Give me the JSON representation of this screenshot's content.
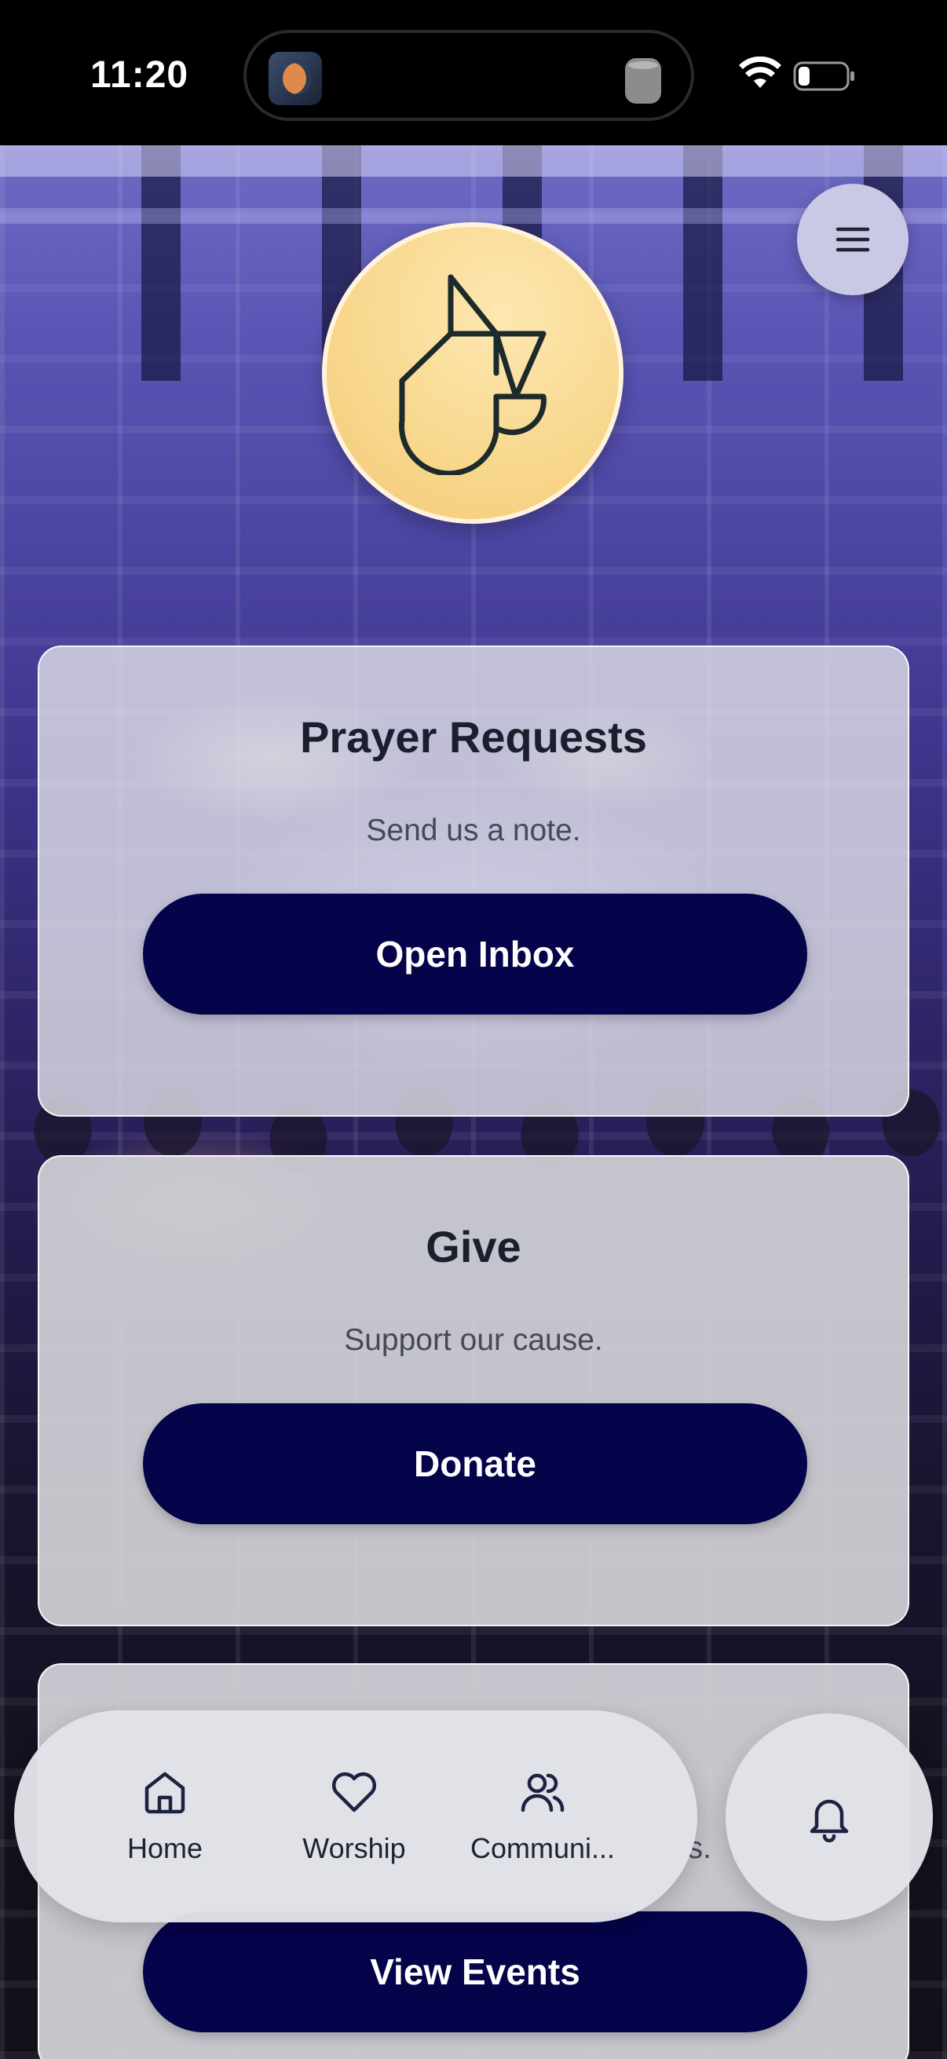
{
  "status_bar": {
    "time": "11:20"
  },
  "header": {
    "menu_icon": "hamburger-menu-icon",
    "logo_icon": "church-logo-icon"
  },
  "cards": [
    {
      "title": "Prayer Requests",
      "subtitle": "Send us a note.",
      "button": "Open Inbox"
    },
    {
      "title": "Give",
      "subtitle": "Support our cause.",
      "button": "Donate"
    },
    {
      "partial_subtitle": "s.",
      "button": "View Events"
    }
  ],
  "tab_bar": {
    "tabs": [
      {
        "label": "Home",
        "icon": "home-icon"
      },
      {
        "label": "Worship",
        "icon": "heart-icon"
      },
      {
        "label": "Communi...",
        "icon": "users-icon"
      }
    ],
    "notifications_icon": "bell-icon"
  },
  "colors": {
    "button": "#05034a",
    "logo_background": "#f8d88e",
    "menu_button": "#c9c9e6"
  }
}
